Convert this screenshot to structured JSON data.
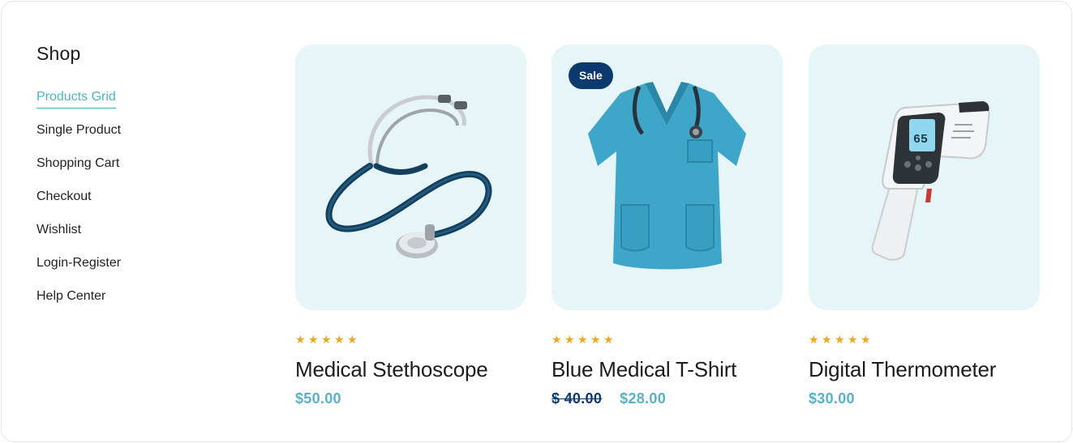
{
  "sidebar": {
    "title": "Shop",
    "items": [
      {
        "label": "Products Grid",
        "active": true
      },
      {
        "label": "Single Product"
      },
      {
        "label": "Shopping Cart"
      },
      {
        "label": "Checkout"
      },
      {
        "label": "Wishlist"
      },
      {
        "label": "Login-Register"
      },
      {
        "label": "Help Center"
      }
    ]
  },
  "products": [
    {
      "name": "Medical Stethoscope",
      "price": "$50.00",
      "rating": 5,
      "image": "stethoscope"
    },
    {
      "name": "Blue Medical T-Shirt",
      "old_price": "$ 40.00",
      "price": "$28.00",
      "badge": "Sale",
      "rating": 5,
      "image": "scrub-shirt"
    },
    {
      "name": "Digital Thermometer",
      "price": "$30.00",
      "rating": 5,
      "image": "thermometer",
      "display_reading": "65"
    }
  ],
  "colors": {
    "accent": "#4fb1c2",
    "price": "#5bb0c3",
    "badge": "#0d3a6e",
    "card_bg": "#e6f5f7",
    "star": "#f5a623"
  }
}
